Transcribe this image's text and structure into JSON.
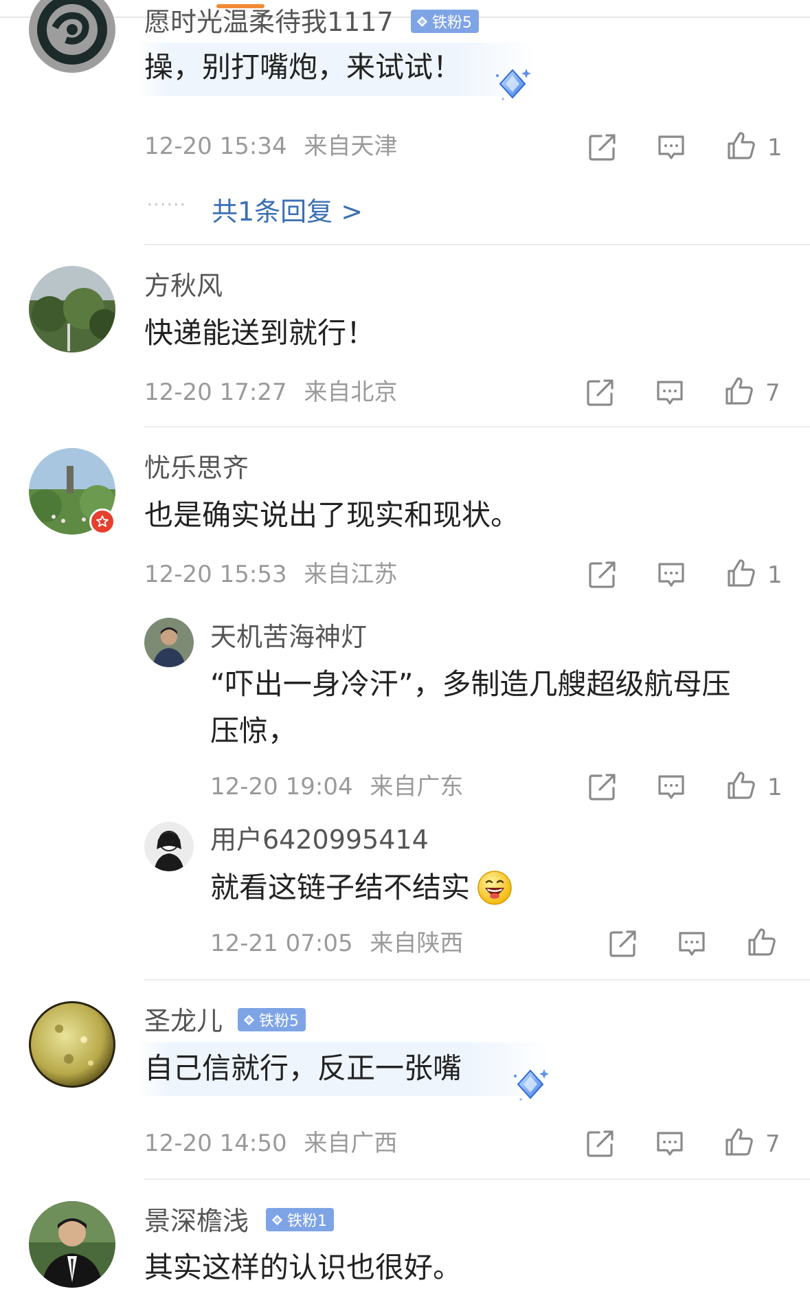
{
  "comments": [
    {
      "name": "愿时光温柔待我1117",
      "badge": "铁粉5",
      "text": "操，别打嘴炮，来试试！",
      "time": "12-20 15:34",
      "location": "来自天津",
      "likes": "1",
      "replies_link": "共1条回复 >"
    },
    {
      "name": "方秋风",
      "text": "快递能送到就行！",
      "time": "12-20 17:27",
      "location": "来自北京",
      "likes": "7"
    },
    {
      "name": "忧乐思齐",
      "text": "也是确实说出了现实和现状。",
      "time": "12-20 15:53",
      "location": "来自江苏",
      "likes": "1",
      "replies": [
        {
          "name": "天机苦海神灯",
          "text_line1": "“吓出一身冷汗”，多制造几艘超级航母压",
          "text_line2": "压惊，",
          "time": "12-20 19:04",
          "location": "来自广东",
          "likes": "1"
        },
        {
          "name": "用户6420995414",
          "text": "就看这链子结不结实",
          "emoji": "laughing-emoji",
          "time": "12-21 07:05",
          "location": "来自陕西",
          "likes": ""
        }
      ]
    },
    {
      "name": "圣龙儿",
      "badge": "铁粉5",
      "text": "自己信就行，反正一张嘴",
      "time": "12-20 14:50",
      "location": "来自广西",
      "likes": "7"
    },
    {
      "name": "景深檐浅",
      "badge": "铁粉1",
      "text": "其实这样的认识也很好。"
    }
  ],
  "icons": {
    "share": "share-icon",
    "comment": "comment-icon",
    "like": "thumbs-up-icon"
  },
  "colors": {
    "accent_tab": "#f08a34",
    "link": "#3a6fb3",
    "badge": "#7ea4e6"
  }
}
